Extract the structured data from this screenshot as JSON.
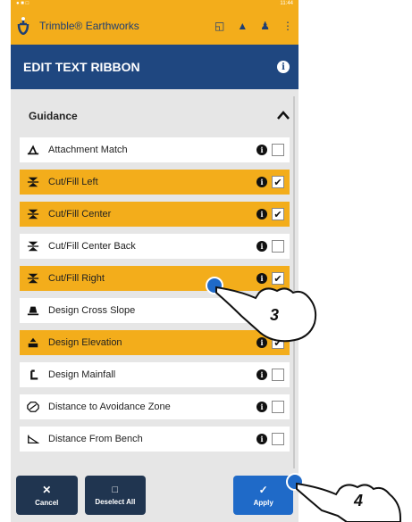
{
  "statusbar": {
    "time": "11:44"
  },
  "app": {
    "name": "Trimble® Earthworks"
  },
  "page": {
    "title": "EDIT TEXT RIBBON"
  },
  "section": {
    "label": "Guidance"
  },
  "items": [
    {
      "label": "Attachment Match",
      "checked": false,
      "icon": "attachment-match-icon"
    },
    {
      "label": "Cut/Fill Left",
      "checked": true,
      "icon": "cut-fill-icon"
    },
    {
      "label": "Cut/Fill Center",
      "checked": true,
      "icon": "cut-fill-icon"
    },
    {
      "label": "Cut/Fill Center Back",
      "checked": false,
      "icon": "cut-fill-icon"
    },
    {
      "label": "Cut/Fill Right",
      "checked": true,
      "icon": "cut-fill-icon"
    },
    {
      "label": "Design Cross Slope",
      "checked": false,
      "icon": "cross-slope-icon"
    },
    {
      "label": "Design Elevation",
      "checked": true,
      "icon": "design-elevation-icon"
    },
    {
      "label": "Design Mainfall",
      "checked": false,
      "icon": "mainfall-icon"
    },
    {
      "label": "Distance to Avoidance Zone",
      "checked": false,
      "icon": "avoidance-zone-icon"
    },
    {
      "label": "Distance From Bench",
      "checked": false,
      "icon": "bench-icon"
    }
  ],
  "buttons": {
    "cancel": "Cancel",
    "deselect_all": "Deselect All",
    "apply": "Apply"
  },
  "annotations": {
    "step3": "3",
    "step4": "4"
  },
  "colors": {
    "accent": "#f3ad1b",
    "navy": "#1f4780",
    "apply_blue": "#1f6ac8"
  }
}
